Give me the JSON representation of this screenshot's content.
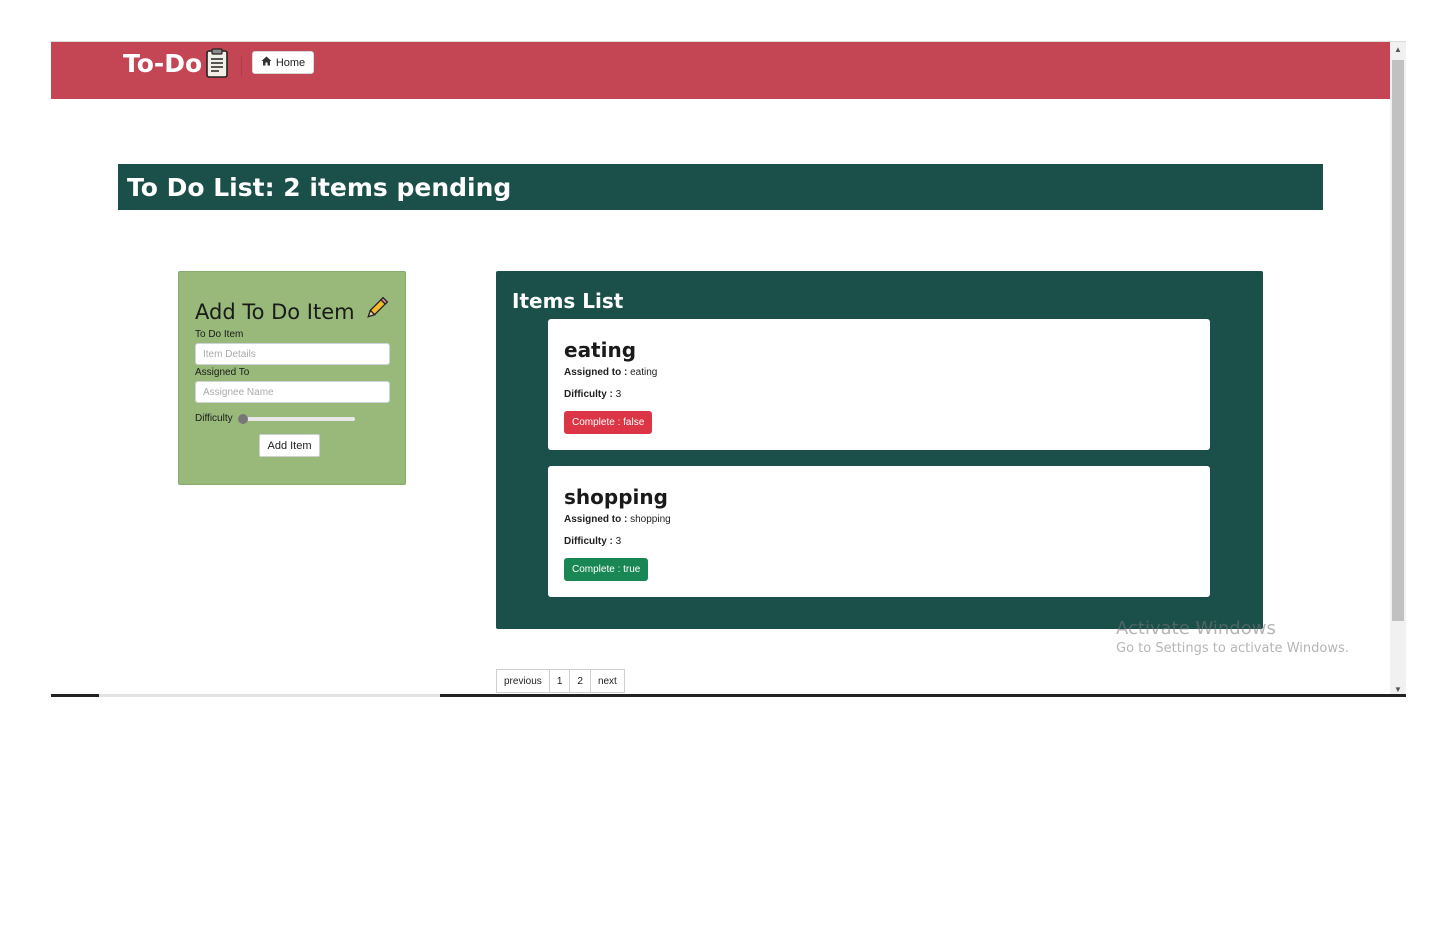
{
  "navbar": {
    "brand": "To-Do",
    "home_label": "Home",
    "color": "#c44655"
  },
  "header": {
    "title": "To Do List: 2 items pending"
  },
  "form": {
    "title": "Add To Do Item",
    "item_label": "To Do Item",
    "item_placeholder": "Item Details",
    "assignee_label": "Assigned To",
    "assignee_placeholder": "Assignee Name",
    "difficulty_label": "Difficulty",
    "difficulty_value": 0,
    "submit_label": "Add Item"
  },
  "items_panel": {
    "title": "Items List",
    "items": [
      {
        "name": "eating",
        "assigned_label": "Assigned to :",
        "assigned_value": "eating",
        "difficulty_label": "Difficulty :",
        "difficulty_value": "3",
        "status_label": "Complete : false",
        "status_color": "#dc3545"
      },
      {
        "name": "shopping",
        "assigned_label": "Assigned to :",
        "assigned_value": "shopping",
        "difficulty_label": "Difficulty :",
        "difficulty_value": "3",
        "status_label": "Complete : true",
        "status_color": "#198754"
      }
    ]
  },
  "pagination": {
    "previous": "previous",
    "pages": [
      "1",
      "2"
    ],
    "next": "next"
  },
  "watermark": {
    "title": "Activate Windows",
    "subtitle": "Go to Settings to activate Windows."
  },
  "colors": {
    "panel": "#1b4f49",
    "form_bg": "#99b97a"
  }
}
